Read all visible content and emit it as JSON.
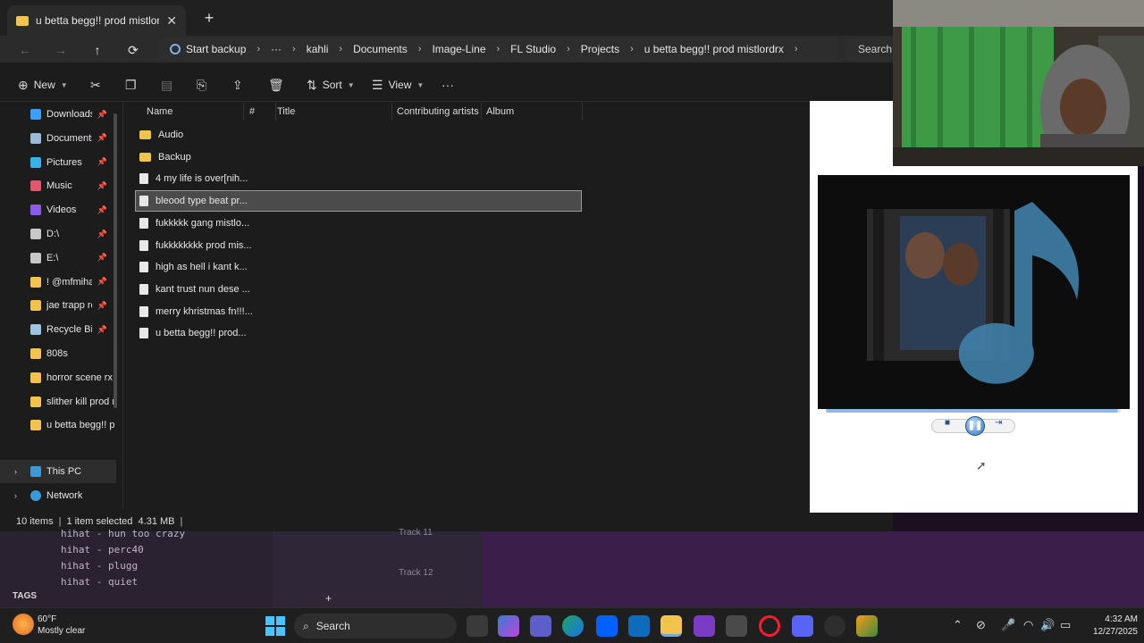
{
  "explorer": {
    "tab": {
      "title": "u betta begg!! prod mistlordrx",
      "close": "✕"
    },
    "new_tab": "+",
    "nav": {
      "back": "←",
      "forward": "→",
      "up": "↑",
      "refresh": "⟳"
    },
    "breadcrumb": {
      "backup": "Start backup",
      "more": "···",
      "items": [
        "kahli",
        "Documents",
        "Image-Line",
        "FL Studio",
        "Projects",
        "u betta begg!! prod mistlordrx"
      ],
      "separator": "›"
    },
    "search_placeholder": "Search",
    "toolbar": {
      "new": "New",
      "sort": "Sort",
      "view": "View",
      "more": "···"
    },
    "navpane": [
      {
        "label": "Downloads",
        "icon": "download-icon",
        "color": "#3aa0ff",
        "pinned": true
      },
      {
        "label": "Documents",
        "icon": "document-icon",
        "color": "#9bb8d8",
        "pinned": true
      },
      {
        "label": "Pictures",
        "icon": "pictures-icon",
        "color": "#3ab0e8",
        "pinned": true
      },
      {
        "label": "Music",
        "icon": "music-icon",
        "color": "#e0566a",
        "pinned": true
      },
      {
        "label": "Videos",
        "icon": "videos-icon",
        "color": "#8e5be8",
        "pinned": true
      },
      {
        "label": "D:\\",
        "icon": "drive-icon",
        "color": "#c8c8c8",
        "pinned": true
      },
      {
        "label": "E:\\",
        "icon": "drive-icon",
        "color": "#c8c8c8",
        "pinned": true
      },
      {
        "label": "!  @mfmihar",
        "icon": "folder-icon",
        "color": "#f3c34d",
        "pinned": true
      },
      {
        "label": "jae trapp recc",
        "icon": "folder-icon",
        "color": "#f3c34d",
        "pinned": true
      },
      {
        "label": "Recycle Bin",
        "icon": "recycle-bin-icon",
        "color": "#9fc3e0",
        "pinned": true
      },
      {
        "label": "808s",
        "icon": "folder-icon",
        "color": "#f3c34d",
        "pinned": false
      },
      {
        "label": "horror scene rx p",
        "icon": "folder-icon",
        "color": "#f3c34d",
        "pinned": false
      },
      {
        "label": "slither kill prod r",
        "icon": "folder-icon",
        "color": "#f3c34d",
        "pinned": false
      },
      {
        "label": "u betta begg!! p",
        "icon": "folder-icon",
        "color": "#f3c34d",
        "pinned": false
      }
    ],
    "pin_glyph": "📌",
    "this_pc": "This PC",
    "network": "Network",
    "columns": [
      "Name",
      "#",
      "Title",
      "Contributing artists",
      "Album"
    ],
    "files": [
      {
        "name": "Audio",
        "type": "folder"
      },
      {
        "name": "Backup",
        "type": "folder"
      },
      {
        "name": "4 my life is over[nih...",
        "type": "file"
      },
      {
        "name": "bleood type beat pr...",
        "type": "file",
        "selected": true
      },
      {
        "name": "fukkkkk gang mistlo...",
        "type": "file"
      },
      {
        "name": "fukkkkkkkk prod mis...",
        "type": "file"
      },
      {
        "name": "high as hell i kant k...",
        "type": "file"
      },
      {
        "name": "kant trust nun dese ...",
        "type": "file"
      },
      {
        "name": "merry khristmas fn!!!...",
        "type": "file"
      },
      {
        "name": "u betta begg!! prod...",
        "type": "file"
      }
    ],
    "status": {
      "items": "10 items",
      "selected": "1 item selected",
      "size": "4.31 MB"
    }
  },
  "media": {
    "progress": 0.99,
    "stop": "■",
    "play_pause": "❚❚",
    "next": "⇥"
  },
  "flstudio": {
    "browser_items": [
      "hihat - hun too crazy",
      "hihat - perc40",
      "hihat - plugg",
      "hihat - quiet"
    ],
    "tags_label": "TAGS",
    "tracks": [
      "Track 11",
      "Track 12"
    ],
    "add": "+"
  },
  "taskbar": {
    "weather": {
      "temp": "60°F",
      "condition": "Mostly clear"
    },
    "search": "Search",
    "time": "4:32 AM",
    "date": "12/27/2025",
    "tray_chevron": "⌃"
  }
}
